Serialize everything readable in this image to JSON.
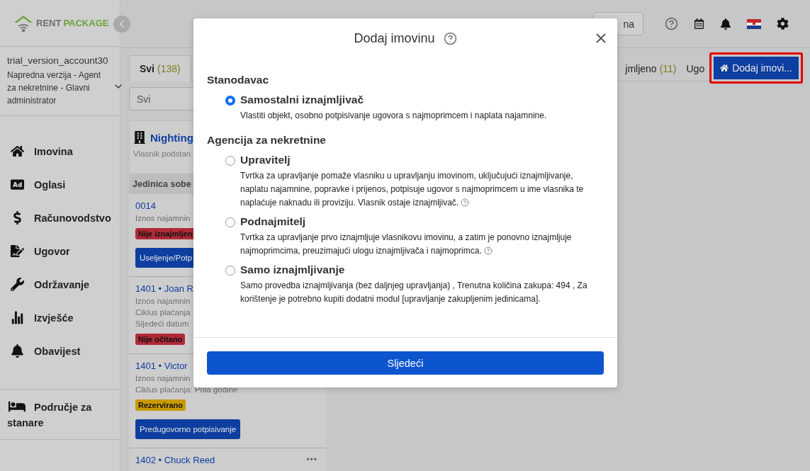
{
  "brand": {
    "first": "RENT",
    "second": "PACKAGE"
  },
  "account": {
    "username": "trial_version_account30",
    "role": "Napredna verzija - Agent za nekretnine - Glavni administrator"
  },
  "nav": [
    {
      "label": "Imovina",
      "kind": "home"
    },
    {
      "label": "Oglasi",
      "kind": "ad"
    },
    {
      "label": "Računovodstvo",
      "kind": "dollar"
    },
    {
      "label": "Ugovor",
      "kind": "sign"
    },
    {
      "label": "Održavanje",
      "kind": "wrench"
    },
    {
      "label": "Izvješće",
      "kind": "chart"
    },
    {
      "label": "Obavijest",
      "kind": "bell"
    }
  ],
  "tenant_area": {
    "label": "Područje za stanare"
  },
  "header": {
    "button": "na"
  },
  "tabs": [
    {
      "label": "Svi",
      "count": "(138)",
      "selected": true
    },
    {
      "label": "jmljeno",
      "count": "(11)",
      "selected": false
    },
    {
      "label": "Ugo",
      "selected": false
    }
  ],
  "add_button": {
    "label": "Dodaj imovi...",
    "highlighted": true
  },
  "filter": {
    "value": "Svi"
  },
  "property": {
    "name": "Nighting",
    "subtitle": "Vlasnik podstan",
    "column": "Jedinica sobe"
  },
  "units": [
    {
      "title": "0014",
      "lines": [
        "Iznos najamnin"
      ],
      "tags": [
        {
          "text": "Nije iznajmljen",
          "color": "#b02a37"
        }
      ],
      "button": "Useljenje/Potp"
    },
    {
      "title": "1401 • Joan R",
      "lines": [
        "Iznos najamnin",
        "Ciklus plaćanja",
        "Sljedeći datum"
      ],
      "tags": [
        {
          "text": "Nije očitano",
          "color": "#b02a37"
        }
      ]
    },
    {
      "title": "1401 • Victor",
      "lines": [
        "Iznos najamnin",
        "Ciklus plaćanja: Pola godine"
      ],
      "tags": [
        {
          "text": "Rezervirano",
          "color": "#c99a00"
        }
      ],
      "button": "Predugovorno potpisivanje"
    },
    {
      "title": "1402 • Chuck Reed",
      "menu": "•••"
    }
  ],
  "modal": {
    "title": "Dodaj imovinu",
    "next": "Sljedeći",
    "sections": [
      {
        "heading": "Stanodavac",
        "options": [
          {
            "label": "Samostalni iznajmljivač",
            "description": "Vlastiti objekt, osobno potpisivanje ugovora s najmoprimcem i naplata najamnine.",
            "selected": true,
            "help": false
          }
        ]
      },
      {
        "heading": "Agencija za nekretnine",
        "options": [
          {
            "label": "Upravitelj",
            "description": "Tvrtka za upravljanje pomaže vlasniku u upravljanju imovinom, uključujući iznajmljivanje, naplatu najamnine, popravke i prijenos, potpisuje ugovor s najmoprimcem u ime vlasnika te naplaćuje naknadu ili proviziju. Vlasnik ostaje iznajmljivač.",
            "selected": false,
            "help": true
          },
          {
            "label": "Podnajmitelj",
            "description": "Tvrtka za upravljanje prvo iznajmljuje vlasnikovu imovinu, a zatim je ponovno iznajmljuje najmoprimcima, preuzimajući ulogu iznajmljivača i najmoprimca.",
            "selected": false,
            "help": true
          },
          {
            "label": "Samo iznajmljivanje",
            "description": "Samo provedba iznajmljivanja (bez daljnjeg upravljanja) , Trenutna količina zakupa: 494 , Za korištenje je potrebno kupiti dodatni modul [upravljanje zakupljenim jedinicama].",
            "selected": false,
            "help": false
          }
        ]
      }
    ]
  }
}
